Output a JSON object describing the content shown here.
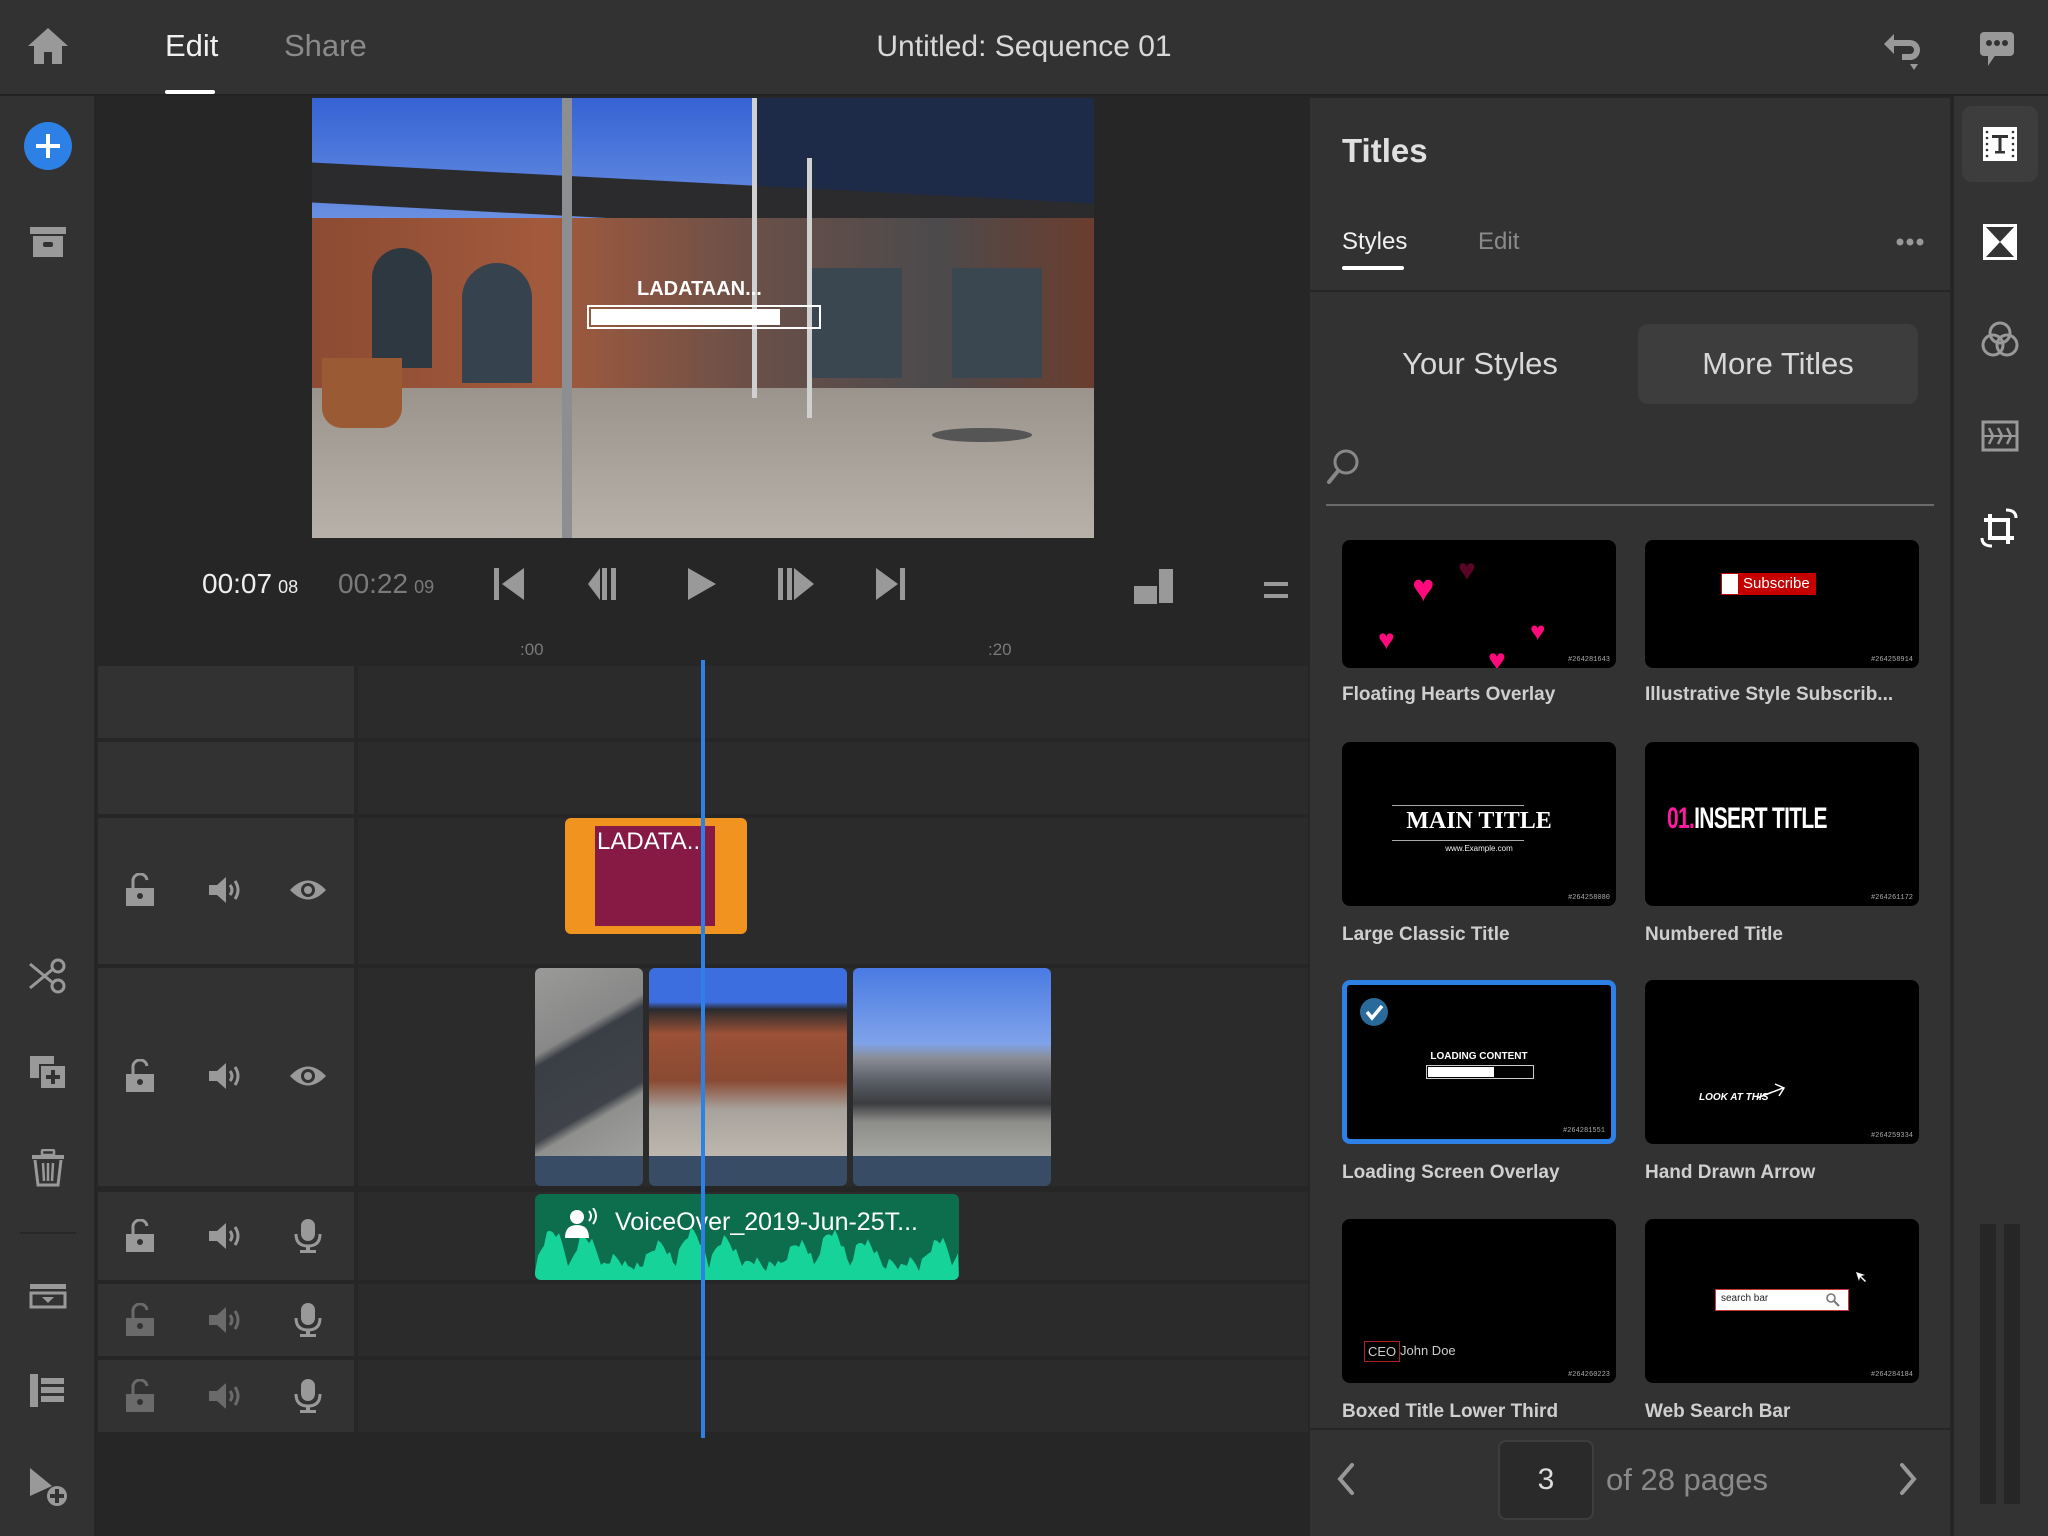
{
  "header": {
    "tabs": [
      {
        "label": "Edit",
        "active": true
      },
      {
        "label": "Share",
        "active": false
      }
    ],
    "title": "Untitled: Sequence 01",
    "icons": [
      "home-icon",
      "undo-icon",
      "feedback-icon"
    ]
  },
  "left_toolbar": {
    "top": [
      "add-media-icon",
      "project-icon"
    ],
    "bottom": [
      "split-icon",
      "duplicate-icon",
      "delete-icon",
      "collapse-track-icon",
      "track-list-icon",
      "add-track-icon"
    ]
  },
  "player": {
    "current_time": "00:07",
    "current_frames": "08",
    "duration": "00:22",
    "duration_frames": "09",
    "preview_overlay_text": "LADATAAN...",
    "preview_overlay_progress": 0.82,
    "controls": [
      "go-to-start",
      "step-back",
      "play",
      "step-forward",
      "go-to-end"
    ],
    "ruler_labels": [
      ":00",
      ":20"
    ]
  },
  "timeline": {
    "title_clip": {
      "label": "LADATA...",
      "color": "#f0941f",
      "inner_color": "#861a45"
    },
    "video_clips": [
      {
        "name": "clip-1"
      },
      {
        "name": "clip-2"
      },
      {
        "name": "clip-3"
      }
    ],
    "audio_clip": {
      "label": "VoiceOver_2019-Jun-25T...",
      "color": "#0c6e4d",
      "wave_color": "#16d39a"
    },
    "playhead_color": "#2d80e6"
  },
  "panel": {
    "title": "Titles",
    "tabs": [
      {
        "label": "Styles",
        "active": true
      },
      {
        "label": "Edit",
        "active": false
      }
    ],
    "more_icon": "more-icon",
    "segment": [
      {
        "label": "Your Styles",
        "active": false
      },
      {
        "label": "More Titles",
        "active": true
      }
    ],
    "search_placeholder": "",
    "items": [
      {
        "label": "Floating Hearts Overlay",
        "id": "#264281643",
        "selected": false
      },
      {
        "label": "Illustrative Style Subscrib...",
        "id": "#264258914",
        "selected": false,
        "thumb_text": "Subscribe"
      },
      {
        "label": "Large Classic Title",
        "id": "#264258080",
        "selected": false,
        "thumb_text": "MAIN TITLE",
        "thumb_sub": "www.Example.com"
      },
      {
        "label": "Numbered Title",
        "id": "#264261172",
        "selected": false,
        "thumb_num": "01.",
        "thumb_text": "INSERT TITLE"
      },
      {
        "label": "Loading Screen Overlay",
        "id": "#264281551",
        "selected": true,
        "thumb_text": "LOADING CONTENT",
        "thumb_progress": 0.62
      },
      {
        "label": "Hand Drawn Arrow",
        "id": "#264259334",
        "selected": false,
        "thumb_text": "LOOK AT THIS"
      },
      {
        "label": "Boxed Title Lower Third",
        "id": "#264260223",
        "selected": false,
        "thumb_box": "CEO",
        "thumb_text": "John Doe"
      },
      {
        "label": "Web Search Bar",
        "id": "#264284184",
        "selected": false,
        "thumb_text": "search bar"
      }
    ],
    "pager": {
      "current": "3",
      "of_label": "of 28 pages"
    }
  },
  "rail": {
    "icons": [
      "titles-icon",
      "transitions-icon",
      "color-icon",
      "audio-icon",
      "transform-icon"
    ]
  },
  "colors": {
    "accent": "#2d80e6",
    "bg": "#262626",
    "panel": "#323232"
  }
}
